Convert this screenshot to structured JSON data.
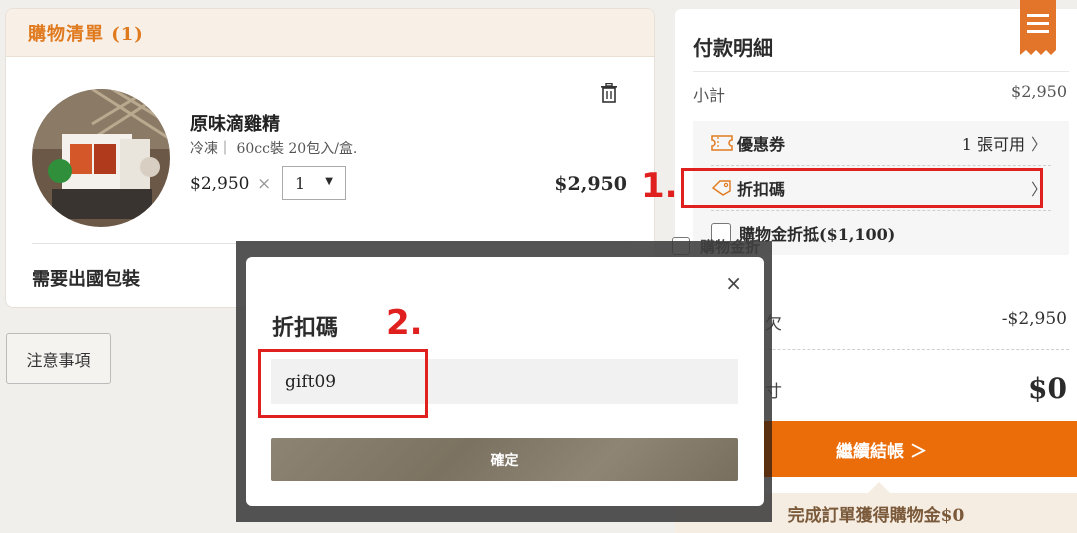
{
  "cart": {
    "title": "購物清單 (1)",
    "item": {
      "name": "原味滴雞精",
      "spec": "冷凍｜ 60cc裝 20包入/盒.",
      "unit_price": "$2,950",
      "times": "×",
      "quantity": "1",
      "line_total": "$2,950"
    },
    "abroad_packaging": "需要出國包裝"
  },
  "notice_button": "注意事項",
  "payment": {
    "title": "付款明細",
    "subtotal_label": "小計",
    "subtotal_value": "$2,950",
    "coupon_label": "優惠券",
    "coupon_count": "1 張可用",
    "discount_code_label": "折扣碼",
    "credit_label": "購物金折抵($1,100)",
    "ghost_credit_label": "購物金折",
    "discount_partial_label": "欠",
    "discount_value": "-$2,950",
    "total_partial_label": "寸",
    "total_value": "$0",
    "checkout_button": "繼續結帳 ＞",
    "reward_banner": "完成訂單獲得購物金$0"
  },
  "modal": {
    "title": "折扣碼",
    "input_value": "gift09",
    "confirm_button": "確定",
    "close": "×"
  },
  "annotations": {
    "step1": "1.",
    "step2": "2."
  },
  "colors": {
    "accent_orange": "#ea6d0a",
    "title_orange": "#e07a1f",
    "annotation_red": "#e0201f"
  }
}
